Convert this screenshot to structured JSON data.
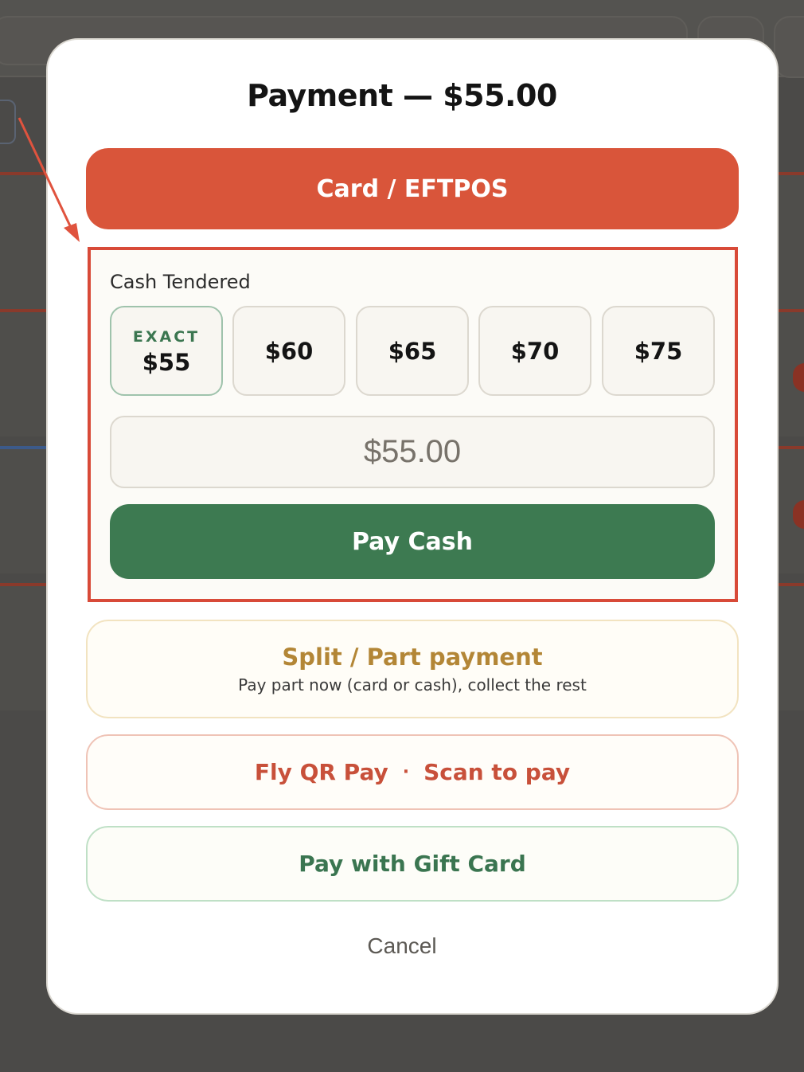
{
  "modal": {
    "title": "Payment — $55.00",
    "card_button": "Card / EFTPOS",
    "cash": {
      "label": "Cash Tendered",
      "exact_tag": "EXACT",
      "amounts": [
        "$55",
        "$60",
        "$65",
        "$70",
        "$75"
      ],
      "input_placeholder": "$55.00",
      "input_value": "",
      "pay_cash_button": "Pay Cash"
    },
    "split": {
      "title": "Split / Part payment",
      "subtitle": "Pay part now (card or cash), collect the rest"
    },
    "qr": {
      "left": "Fly QR Pay",
      "separator": "·",
      "right": "Scan to pay"
    },
    "gift_card_button": "Pay with Gift Card",
    "cancel_button": "Cancel"
  },
  "colors": {
    "card_accent": "#d9553a",
    "cash_green": "#3d7a51",
    "split_gold": "#b38636",
    "qr_red": "#c8503a",
    "gift_green": "#3a7550",
    "highlight_red": "#d84a38"
  },
  "annotation": {
    "type": "arrow-and-highlight-box"
  }
}
